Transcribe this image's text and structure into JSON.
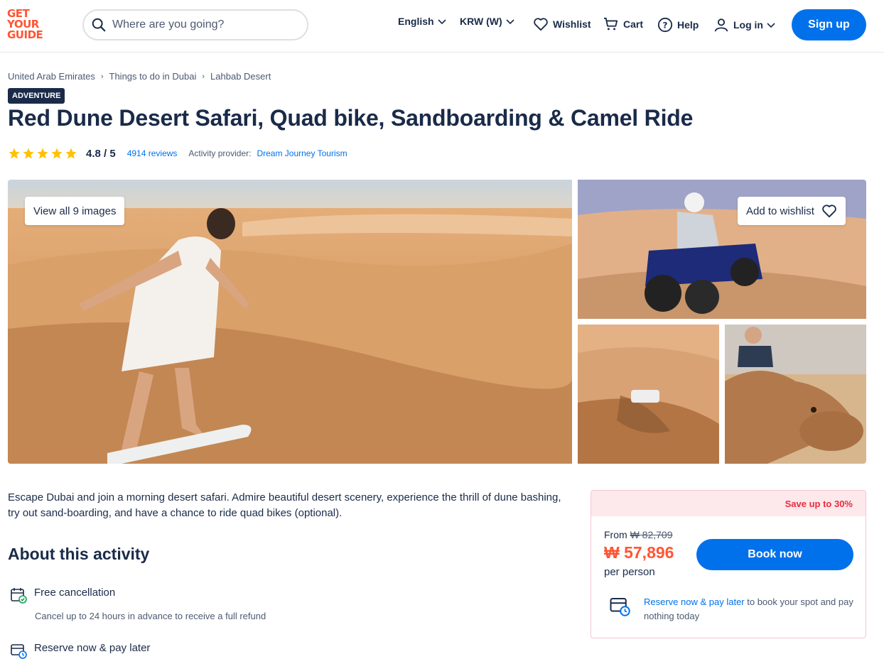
{
  "header": {
    "logo_lines": [
      "GET",
      "YOUR",
      "GUIDE"
    ],
    "search_placeholder": "Where are you going?",
    "language": "English",
    "currency": "KRW (W)",
    "wishlist": "Wishlist",
    "cart": "Cart",
    "help": "Help",
    "login": "Log in",
    "signup": "Sign up"
  },
  "breadcrumb": [
    "United Arab Emirates",
    "Things to do in Dubai",
    "Lahbab Desert"
  ],
  "badge": "ADVENTURE",
  "title": "Red Dune Desert Safari, Quad bike, Sandboarding & Camel Ride",
  "rating": {
    "stars": 5,
    "value": "4.8 / 5",
    "reviews": "4914 reviews",
    "provider_label": "Activity provider:",
    "provider": "Dream Journey Tourism"
  },
  "gallery": {
    "view_all": "View all 9 images",
    "add_wishlist": "Add to wishlist"
  },
  "description": "Escape Dubai and join a morning desert safari. Admire beautiful desert scenery, experience the thrill of dune bashing, try out sand-boarding, and have a chance to ride quad bikes (optional).",
  "about": {
    "title": "About this activity",
    "features": [
      {
        "title": "Free cancellation",
        "subtitle": "Cancel up to 24 hours in advance to receive a full refund"
      },
      {
        "title": "Reserve now & pay later",
        "subtitle": ""
      }
    ]
  },
  "booking": {
    "save": "Save up to 30%",
    "from_label": "From",
    "old_price": "₩ 82,709",
    "price": "₩ 57,896",
    "per": "per person",
    "book": "Book now",
    "reserve_link": "Reserve now & pay later",
    "reserve_text": " to book your spot and pay nothing today"
  },
  "colors": {
    "brand": "#ff5533",
    "primary": "#0071eb",
    "text": "#1a2b49",
    "star": "#ffc107"
  }
}
